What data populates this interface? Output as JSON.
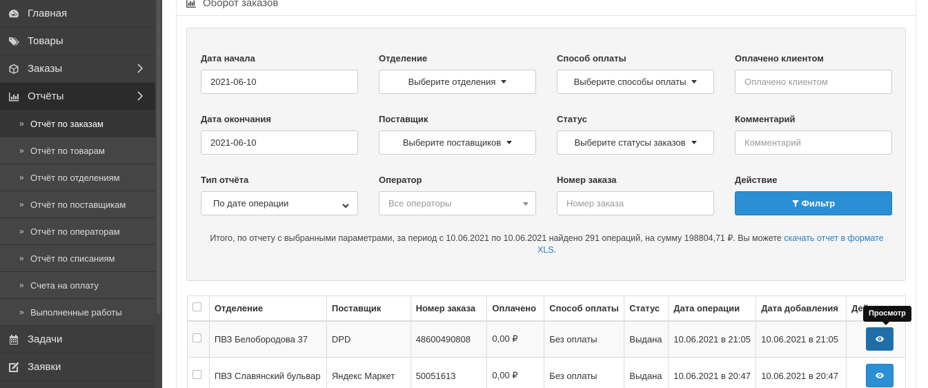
{
  "sidebar": {
    "items": [
      {
        "label": "Главная",
        "icon": "dashboard-icon"
      },
      {
        "label": "Товары",
        "icon": "tags-icon"
      },
      {
        "label": "Заказы",
        "icon": "cube-icon"
      },
      {
        "label": "Отчёты",
        "icon": "bar-chart-icon"
      },
      {
        "label": "Задачи",
        "icon": "calendar-icon"
      },
      {
        "label": "Заявки",
        "icon": "edit-icon"
      }
    ],
    "sub_items": [
      "Отчёт по заказам",
      "Отчёт по товарам",
      "Отчёт по отделениям",
      "Отчёт по поставщикам",
      "Отчёт по операторам",
      "Отчёт по списаниям",
      "Счета на оплату",
      "Выполненные работы"
    ]
  },
  "panel": {
    "title": "Оборот заказов"
  },
  "filters": {
    "start_date": {
      "label": "Дата начала",
      "value": "2021-06-10"
    },
    "end_date": {
      "label": "Дата окончания",
      "value": "2021-06-10"
    },
    "report_type": {
      "label": "Тип отчёта",
      "value": "По дате операции"
    },
    "department": {
      "label": "Отделение",
      "value": "Выберите отделения"
    },
    "supplier": {
      "label": "Поставщик",
      "value": "Выберите поставщиков"
    },
    "operator": {
      "label": "Оператор",
      "value": "Все операторы"
    },
    "payment_method": {
      "label": "Способ оплаты",
      "value": "Выберите способы оплаты"
    },
    "status": {
      "label": "Статус",
      "value": "Выберите статусы заказов"
    },
    "order_number": {
      "label": "Номер заказа",
      "placeholder": "Номер заказа"
    },
    "paid_by_client": {
      "label": "Оплачено клиентом",
      "placeholder": "Оплачено клиентом"
    },
    "comment": {
      "label": "Комментарий",
      "placeholder": "Комментарий"
    },
    "action": {
      "label": "Действие",
      "button": "Фильтр"
    }
  },
  "summary": {
    "text": "Итого, по отчету с выбранными параметрами, за период с 10.06.2021 по 10.06.2021 найдено 291 операций, на сумму 198804,71 ₽. Вы можете ",
    "link": "скачать отчет в формате XLS",
    "end": "."
  },
  "table": {
    "headers": [
      "Отделение",
      "Поставщик",
      "Номер заказа",
      "Оплачено",
      "Способ оплаты",
      "Статус",
      "Дата операции",
      "Дата добавления",
      "Дей"
    ],
    "rows": [
      [
        "ПВЗ Белобородова 37",
        "DPD",
        "48600490808",
        "0,00 ₽",
        "Без оплаты",
        "Выдана",
        "10.06.2021 в 21:05",
        "10.06.2021 в 21:05"
      ],
      [
        "ПВЗ Славянский бульвар",
        "Яндекс Маркет",
        "50051613",
        "0,00 ₽",
        "Без оплаты",
        "Выдана",
        "10.06.2021 в 20:47",
        "10.06.2021 в 20:47"
      ]
    ],
    "tooltip": "Просмотр"
  }
}
